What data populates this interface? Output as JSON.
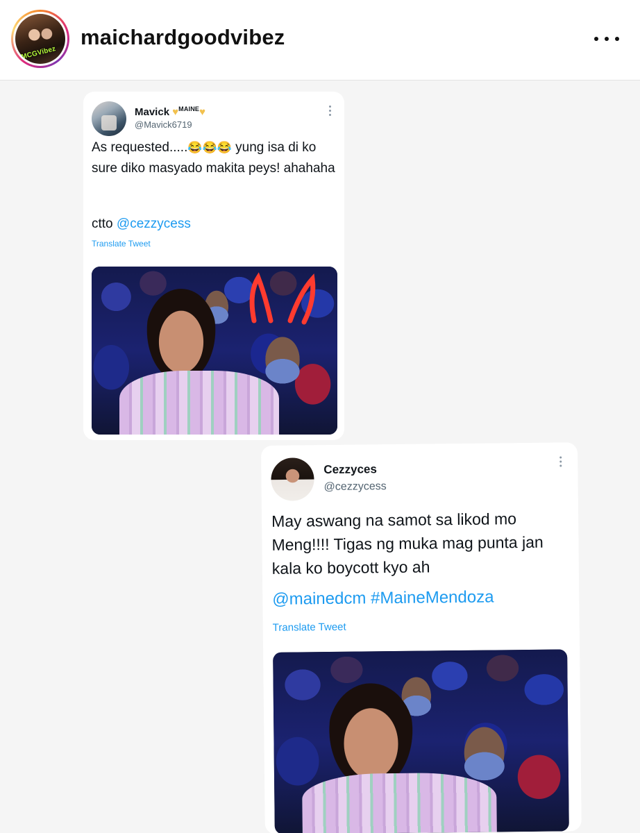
{
  "header": {
    "username": "maichardgoodvibez",
    "avatar_badge": "MCGVibez",
    "more_icon": "more-horizontal-icon"
  },
  "tweets": [
    {
      "name": "Mavick",
      "name_suffix": "MAINE",
      "handle": "@Mavick6719",
      "body": "As requested.....",
      "emoji": "😂😂😂",
      "body_rest": " yung isa di ko sure diko masyado makita peys! ahahaha",
      "ctto_label": "ctto ",
      "mention": "@cezzycess",
      "translate": "Translate Tweet"
    },
    {
      "name": "Cezzyces",
      "handle": "@cezzycess",
      "body": "May aswang na samot sa likod mo Meng!!!! Tigas ng muka mag punta jan kala ko boycott kyo ah",
      "mentions": "@mainedcm #MaineMendoza",
      "translate": "Translate Tweet"
    }
  ],
  "colors": {
    "link": "#1d9bf0",
    "heart": "#f2c14e",
    "background": "#f5f5f5"
  }
}
